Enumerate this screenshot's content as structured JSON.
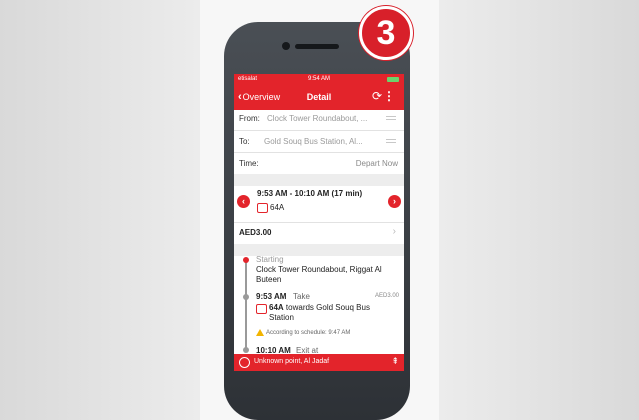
{
  "badge": {
    "number": "3"
  },
  "status_bar": {
    "carrier": "etisalat",
    "time": "9:54 AM"
  },
  "nav": {
    "back_label": "Overview",
    "title": "Detail",
    "more_glyph": "⋮",
    "refresh_glyph": "⟳",
    "back_glyph": "‹"
  },
  "form": {
    "from_label": "From:",
    "from_value": "Clock Tower Roundabout, ...",
    "to_label": "To:",
    "to_value": "Gold Souq Bus Station, Al...",
    "time_label": "Time:",
    "time_value": "Depart Now"
  },
  "trip": {
    "summary": "9:53 AM - 10:10 AM (17 min)",
    "route": "64A",
    "fare": "AED3.00"
  },
  "steps": {
    "start_label": "Starting",
    "start_place": "Clock Tower Roundabout, Riggat Al Buteen",
    "take_time": "9:53 AM",
    "take_label": "Take",
    "take_fare": "AED3.00",
    "take_route": "64A",
    "take_towards": "towards Gold Souq Bus Station",
    "schedule_note": "According to schedule: 9:47 AM",
    "exit_time": "10:10 AM",
    "exit_label": "Exit at"
  },
  "footer": {
    "location": "Unknown point, Al Jadaf"
  },
  "colors": {
    "accent": "#e3242b",
    "warning": "#f2b400"
  }
}
